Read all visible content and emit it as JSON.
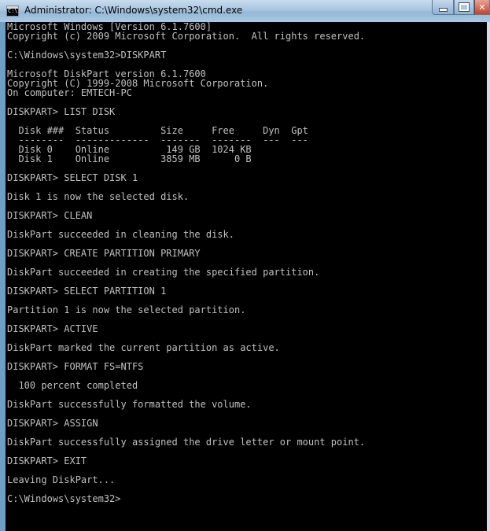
{
  "window": {
    "title": "Administrator: C:\\Windows\\system32\\cmd.exe",
    "icon_text": "C:\\.",
    "close_glyph": "✕"
  },
  "console": {
    "lines": [
      "Microsoft Windows [Version 6.1.7600]",
      "Copyright (c) 2009 Microsoft Corporation.  All rights reserved.",
      "",
      "C:\\Windows\\system32>DISKPART",
      "",
      "Microsoft DiskPart version 6.1.7600",
      "Copyright (C) 1999-2008 Microsoft Corporation.",
      "On computer: EMTECH-PC",
      "",
      "DISKPART> LIST DISK",
      "",
      "  Disk ###  Status         Size     Free     Dyn  Gpt",
      "  --------  -------------  -------  -------  ---  ---",
      "  Disk 0    Online          149 GB  1024 KB",
      "  Disk 1    Online         3859 MB      0 B",
      "",
      "DISKPART> SELECT DISK 1",
      "",
      "Disk 1 is now the selected disk.",
      "",
      "DISKPART> CLEAN",
      "",
      "DiskPart succeeded in cleaning the disk.",
      "",
      "DISKPART> CREATE PARTITION PRIMARY",
      "",
      "DiskPart succeeded in creating the specified partition.",
      "",
      "DISKPART> SELECT PARTITION 1",
      "",
      "Partition 1 is now the selected partition.",
      "",
      "DISKPART> ACTIVE",
      "",
      "DiskPart marked the current partition as active.",
      "",
      "DISKPART> FORMAT FS=NTFS",
      "",
      "  100 percent completed",
      "",
      "DiskPart successfully formatted the volume.",
      "",
      "DISKPART> ASSIGN",
      "",
      "DiskPart successfully assigned the drive letter or mount point.",
      "",
      "DISKPART> EXIT",
      "",
      "Leaving DiskPart...",
      "",
      "C:\\Windows\\system32>"
    ]
  }
}
